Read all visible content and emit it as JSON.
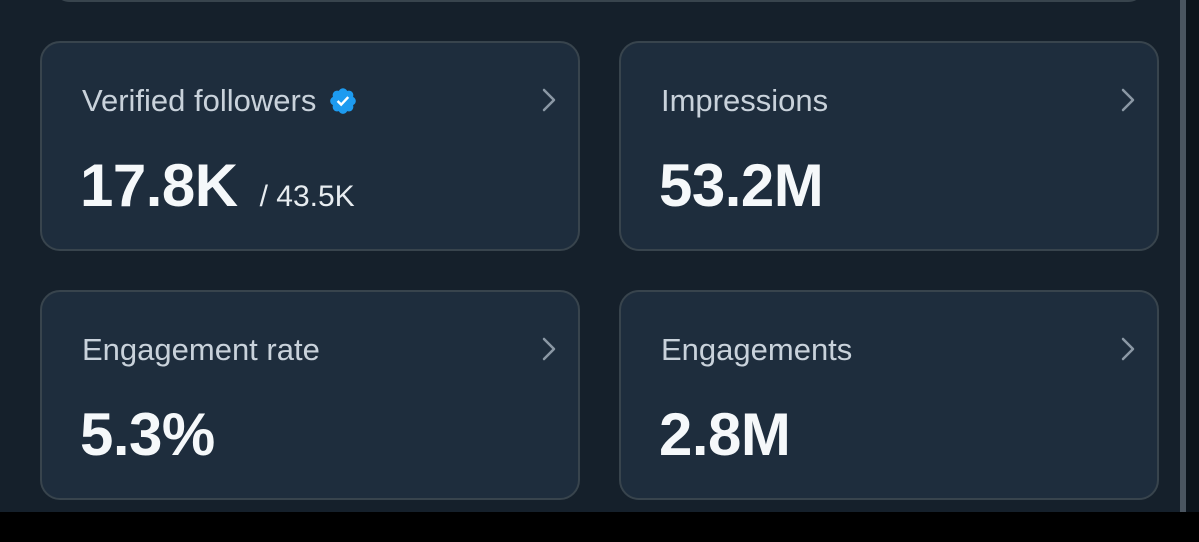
{
  "cards": [
    {
      "label": "Verified followers",
      "value": "17.8K",
      "sub_value": "/ 43.5K"
    },
    {
      "label": "Impressions",
      "value": "53.2M"
    },
    {
      "label": "Engagement rate",
      "value": "5.3%"
    },
    {
      "label": "Engagements",
      "value": "2.8M"
    }
  ],
  "colors": {
    "background": "#15202b",
    "card": "#1e2d3d",
    "border": "#38444d",
    "verified": "#1d9bf0",
    "label": "#c9d2db",
    "value": "#f5f8fa"
  },
  "icons": {
    "verified": "verified-badge-icon",
    "chevron": "chevron-right-icon"
  }
}
